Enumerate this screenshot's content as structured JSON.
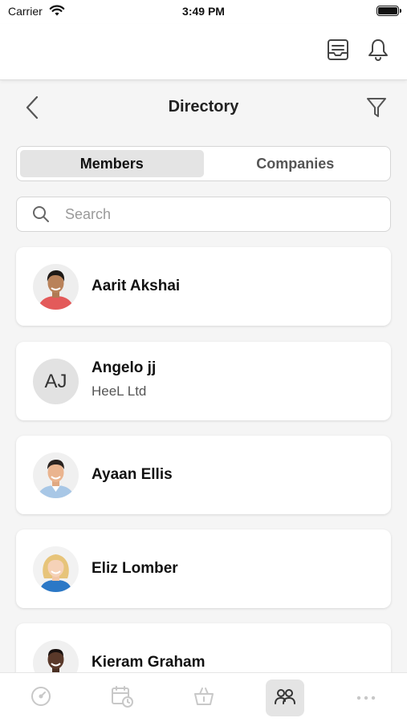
{
  "status_bar": {
    "carrier": "Carrier",
    "time": "3:49 PM"
  },
  "header": {
    "icons": [
      "document-list-icon",
      "bell-icon"
    ]
  },
  "nav": {
    "title": "Directory",
    "back_icon": "chevron-left-icon",
    "filter_icon": "filter-icon"
  },
  "segmented": {
    "members_label": "Members",
    "companies_label": "Companies",
    "selected": "Members"
  },
  "search": {
    "placeholder": "Search",
    "value": ""
  },
  "members": [
    {
      "name": "Aarit Akshai",
      "company": "",
      "avatar": "photo"
    },
    {
      "name": "Angelo jj",
      "company": "HeeL Ltd",
      "avatar": "initials",
      "initials": "AJ"
    },
    {
      "name": "Ayaan Ellis",
      "company": "",
      "avatar": "photo"
    },
    {
      "name": "Eliz Lomber",
      "company": "",
      "avatar": "photo"
    },
    {
      "name": "Kieram Graham",
      "company": "",
      "avatar": "photo"
    }
  ],
  "tab_bar": {
    "tabs": [
      "dashboard-icon",
      "calendar-clock-icon",
      "basket-icon",
      "people-icon",
      "more-icon"
    ],
    "active": "people-icon"
  },
  "colors": {
    "background": "#f5f5f5",
    "card": "#ffffff",
    "segment_active": "#e4e4e4",
    "tab_inactive": "#c8c8c8"
  }
}
